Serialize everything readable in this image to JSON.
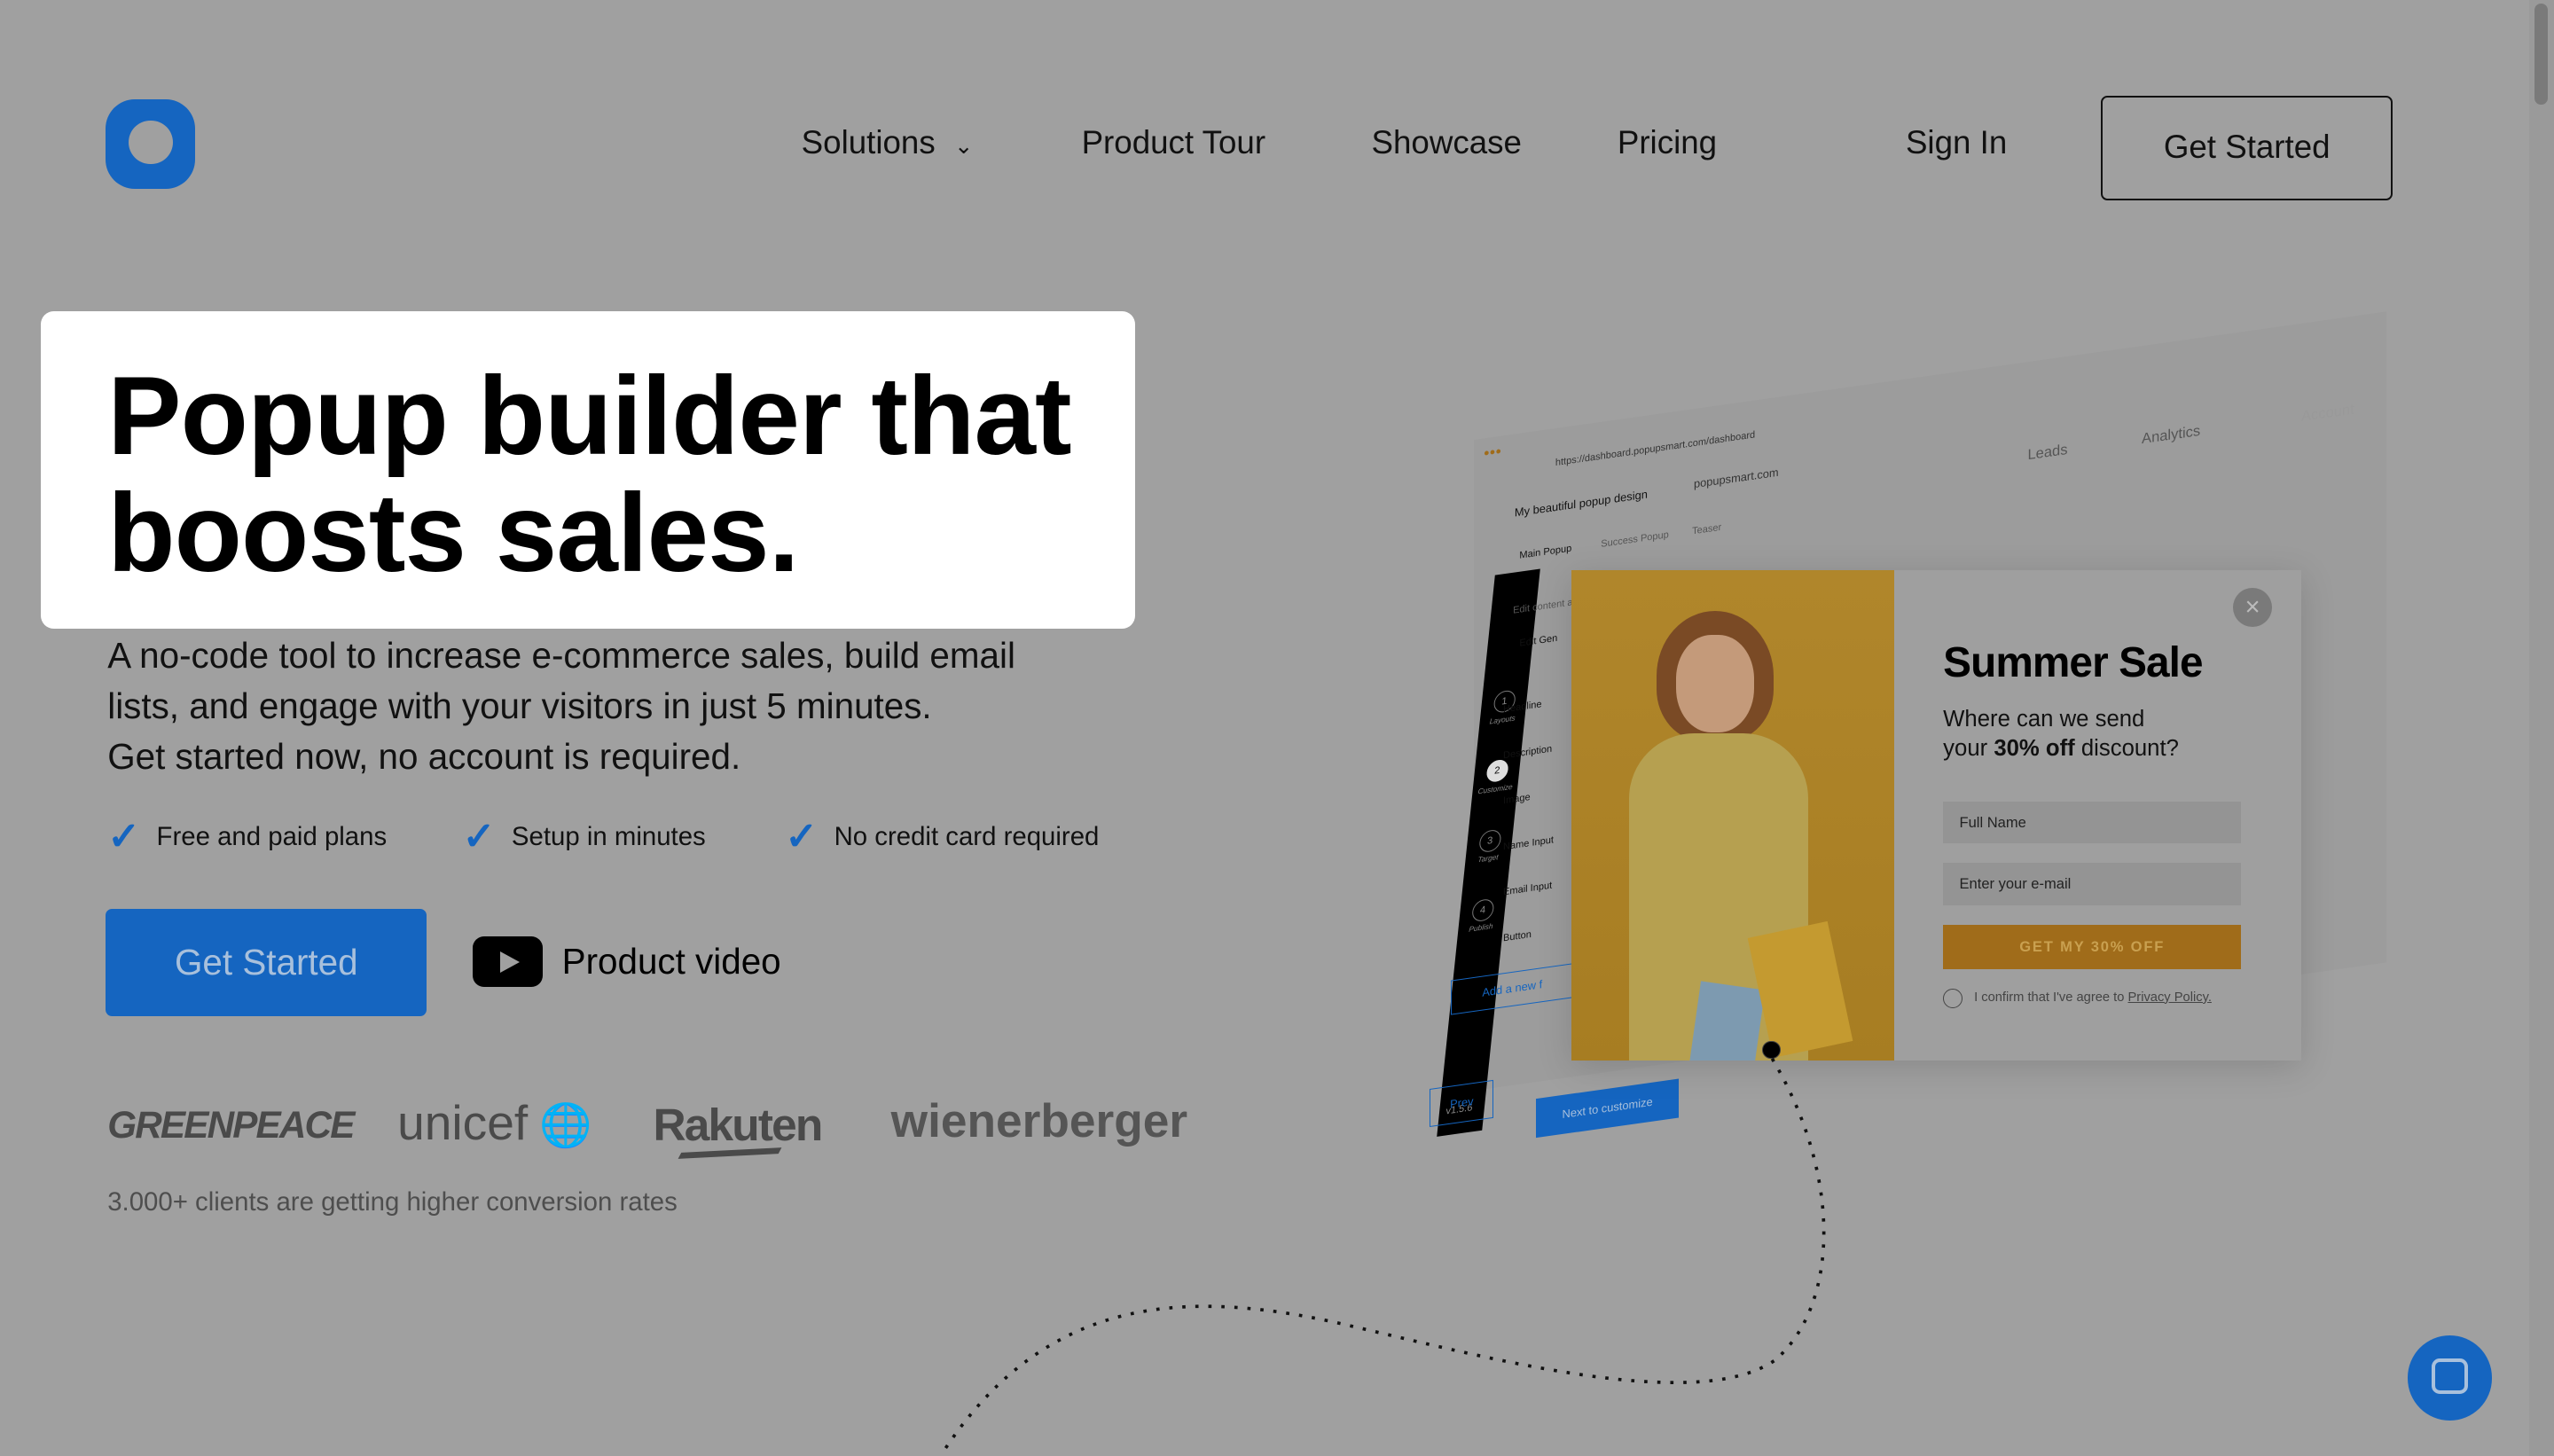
{
  "nav": {
    "items": [
      "Solutions",
      "Product Tour",
      "Showcase",
      "Pricing"
    ],
    "sign_in": "Sign In",
    "get_started": "Get Started"
  },
  "hero": {
    "title_line1": "Popup builder that",
    "title_line2": "boosts sales.",
    "subtitle_line1": "A no-code tool to increase e-commerce sales, build email",
    "subtitle_line2": "lists, and engage with your visitors in just 5 minutes.",
    "subtitle_line3": "Get started now, no account is required.",
    "features": [
      "Free and paid plans",
      "Setup in minutes",
      "No credit card required"
    ],
    "cta": "Get Started",
    "video": "Product video"
  },
  "clients": {
    "logos": [
      "GREENPEACE",
      "unicef",
      "Rakuten",
      "wienerberger"
    ],
    "caption": "3.000+ clients are getting higher conversion rates"
  },
  "mockup": {
    "url": "https://dashboard.popupsmart.com/dashboard",
    "leads": "Leads",
    "analytics": "Analytics",
    "account": "Account",
    "design_name": "My beautiful popup design",
    "site": "popupsmart.com",
    "tabs": [
      "Main Popup",
      "Success Popup",
      "Teaser"
    ],
    "edit_content": "Edit content an",
    "edit_general": "Edit Gen",
    "elements": [
      "Headline",
      "Description",
      "Image",
      "Name Input",
      "Email Input",
      "Button"
    ],
    "add_new": "Add a new f",
    "steps": [
      {
        "n": "1",
        "label": "Layouts"
      },
      {
        "n": "2",
        "label": "Customize"
      },
      {
        "n": "3",
        "label": "Target"
      },
      {
        "n": "4",
        "label": "Publish"
      }
    ],
    "version": "v1.5.6",
    "prev": "Prev",
    "next": "Next to customize",
    "popup": {
      "title": "Summer Sale",
      "text_line1": "Where can we send",
      "text_pre": "your ",
      "text_bold": "30% off",
      "text_post": " discount?",
      "name_placeholder": "Full Name",
      "email_placeholder": "Enter your e-mail",
      "button": "GET MY 30% OFF",
      "consent": "I confirm that I've agree to ",
      "consent_link": "Privacy Policy."
    }
  },
  "colors": {
    "brand": "#1565c0",
    "overlay_bg": "#a0a0a0",
    "popup_button": "#a06c1a"
  }
}
